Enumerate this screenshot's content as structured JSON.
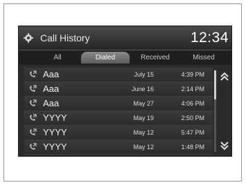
{
  "header": {
    "title": "Call History",
    "clock": "12:34"
  },
  "tabs": [
    {
      "label": "All",
      "selected": false
    },
    {
      "label": "Dialed",
      "selected": true
    },
    {
      "label": "Received",
      "selected": false
    },
    {
      "label": "Missed",
      "selected": false
    }
  ],
  "calls": [
    {
      "name": "Aaa",
      "date": "July 15",
      "time": "4:39 PM"
    },
    {
      "name": "Aaa",
      "date": "June 16",
      "time": "2:14 PM"
    },
    {
      "name": "Aaa",
      "date": "May 27",
      "time": "4:06 PM"
    },
    {
      "name": "YYYY",
      "date": "May 19",
      "time": "2:50 PM"
    },
    {
      "name": "YYYY",
      "date": "May 12",
      "time": "5:47 PM"
    },
    {
      "name": "YYYY",
      "date": "May 12",
      "time": "1:48 PM"
    }
  ],
  "icons": {
    "settings": "gear-icon",
    "call": "phone-outgoing-icon",
    "scroll_up": "double-chevron-up-icon",
    "scroll_down": "double-chevron-down-icon"
  }
}
